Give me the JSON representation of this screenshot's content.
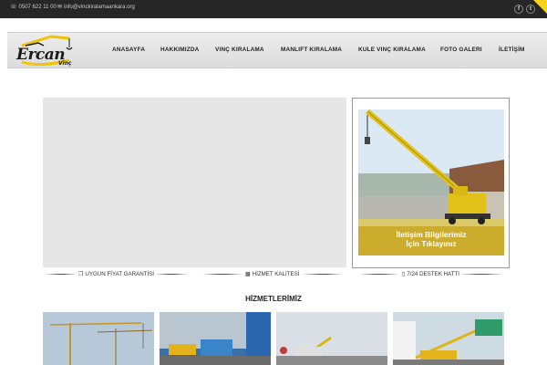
{
  "topbar": {
    "phone": "0507 622 11 00",
    "email": "info@vinckiralamaankara.org",
    "social": [
      "f",
      "t"
    ],
    "icons": [
      "phone-icon",
      "mail-icon",
      "facebook-icon",
      "twitter-icon"
    ],
    "accent_color": "#f5d31a"
  },
  "logo": {
    "name": "Ercan",
    "sub": "Vinç"
  },
  "nav": {
    "items": [
      "ANASAYFA",
      "HAKKIMIZDA",
      "VINÇ KIRALAMA",
      "MANLIFT KIRALAMA",
      "KULE VINÇ KIRALAMA",
      "FOTO GALERI",
      "İLETİŞİM"
    ]
  },
  "promo": {
    "line1": "İletişim Bilgilerimiz",
    "line2": "İçin Tıklayınız"
  },
  "features": [
    "UYGUN FİYAT GARANTİSİ",
    "HİZMET KALİTESİ",
    "7/24 DESTEK HATTI"
  ],
  "services": {
    "title": "HİZMETLERİMİZ"
  }
}
